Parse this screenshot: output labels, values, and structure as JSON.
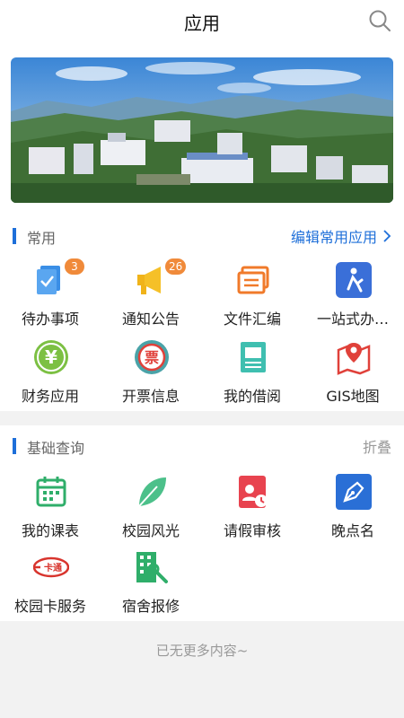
{
  "header": {
    "title": "应用",
    "search_icon": "search-icon"
  },
  "common": {
    "title": "常用",
    "action": "编辑常用应用",
    "items": [
      {
        "label": "待办事项",
        "icon": "todo-icon",
        "badge": "3"
      },
      {
        "label": "通知公告",
        "icon": "megaphone-icon",
        "badge": "26"
      },
      {
        "label": "文件汇编",
        "icon": "documents-icon"
      },
      {
        "label": "一站式办…",
        "icon": "one-stop-icon"
      },
      {
        "label": "财务应用",
        "icon": "yen-coin-icon"
      },
      {
        "label": "开票信息",
        "icon": "invoice-icon"
      },
      {
        "label": "我的借阅",
        "icon": "book-icon"
      },
      {
        "label": "GIS地图",
        "icon": "map-pin-icon"
      }
    ]
  },
  "basic": {
    "title": "基础查询",
    "action": "折叠",
    "items": [
      {
        "label": "我的课表",
        "icon": "calendar-icon"
      },
      {
        "label": "校园风光",
        "icon": "leaf-icon"
      },
      {
        "label": "请假审核",
        "icon": "leave-review-icon"
      },
      {
        "label": "晚点名",
        "icon": "pen-icon"
      },
      {
        "label": "校园卡服务",
        "icon": "campus-card-icon",
        "icon_text": "卡通"
      },
      {
        "label": "宿舍报修",
        "icon": "dorm-repair-icon"
      }
    ]
  },
  "invoice_icon_text": "票",
  "yen_icon_text": "¥",
  "footer": {
    "text": "已无更多内容~"
  },
  "colors": {
    "accent": "#1e6fd9",
    "badge": "#f08a3a",
    "orange": "#f07a2a",
    "red": "#e0413a",
    "green": "#33b07a"
  }
}
